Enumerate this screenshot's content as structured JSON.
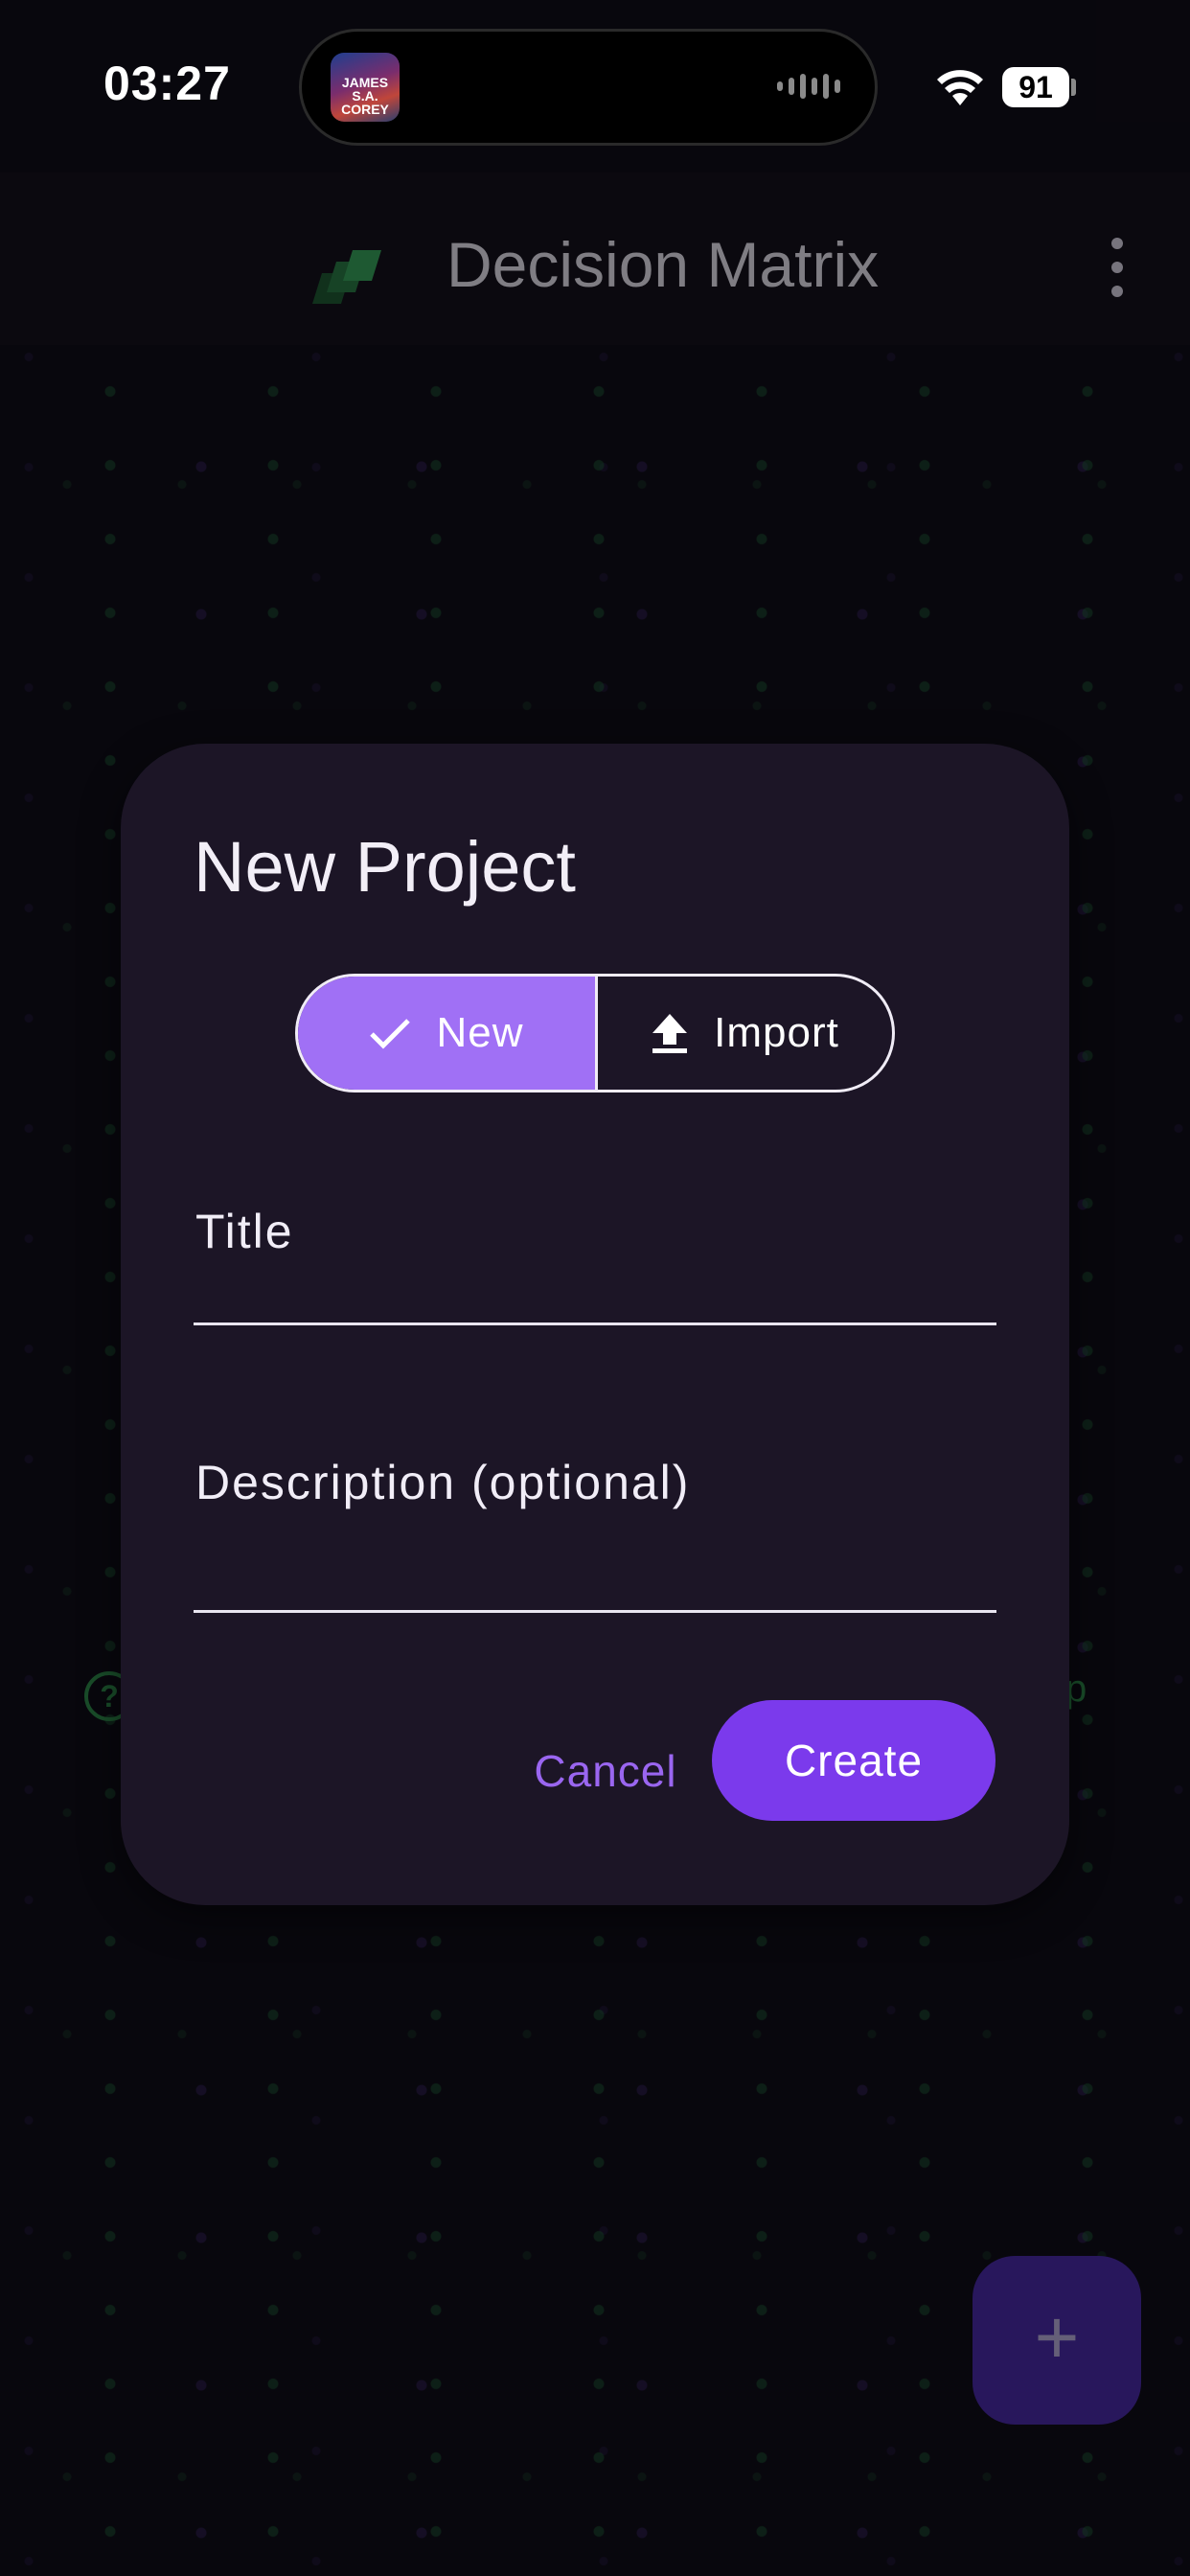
{
  "status_bar": {
    "time": "03:27",
    "battery_level": "91",
    "now_playing_art_text": "JAMES S.A. COREY"
  },
  "app_bar": {
    "title": "Decision Matrix"
  },
  "background": {
    "help_icon_glyph": "?",
    "help_text_fragment": "p"
  },
  "dialog": {
    "title": "New Project",
    "segments": [
      {
        "label": "New",
        "icon": "check-icon",
        "selected": true
      },
      {
        "label": "Import",
        "icon": "upload-icon",
        "selected": false
      }
    ],
    "fields": {
      "title_label": "Title",
      "title_value": "",
      "description_label": "Description (optional)",
      "description_value": ""
    },
    "actions": {
      "cancel_label": "Cancel",
      "create_label": "Create"
    }
  },
  "fab": {
    "icon": "plus-icon",
    "glyph": "+"
  },
  "colors": {
    "accent": "#7b3aec",
    "selected_segment": "#a070f5",
    "cancel_text": "#9a66f0",
    "dialog_bg": "#1c1526",
    "matrix_green": "#2e8a4b",
    "fab_bg": "#4a2aa8"
  }
}
